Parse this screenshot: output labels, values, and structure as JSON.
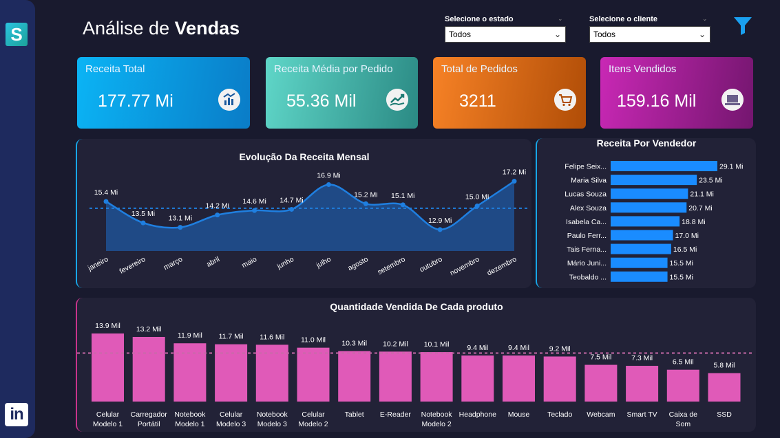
{
  "header": {
    "title_light": "Análise de ",
    "title_bold": "Vendas"
  },
  "filters": [
    {
      "label": "Selecione o estado",
      "value": "Todos"
    },
    {
      "label": "Selecione o cliente",
      "value": "Todos"
    }
  ],
  "kpis": [
    {
      "label": "Receita Total",
      "value": "177.77 Mi",
      "icon": "money-chart-icon"
    },
    {
      "label": "Receita Média por Pedido",
      "value": "55.36 Mil",
      "icon": "trend-hand-icon"
    },
    {
      "label": "Total de Pedidos",
      "value": "3211",
      "icon": "cart-icon"
    },
    {
      "label": "Itens Vendidos",
      "value": "159.16 Mil",
      "icon": "laptop-icon"
    }
  ],
  "colors": {
    "background": "#191a2e",
    "panel": "#222237",
    "line": "#1f7fe0",
    "area": "#1f4f8f",
    "bar_blue": "#1a8cff",
    "bar_pink": "#e05ab8"
  },
  "chart_data": [
    {
      "type": "area",
      "title": "Evolução Da Receita Mensal",
      "categories": [
        "janeiro",
        "fevereiro",
        "março",
        "abril",
        "maio",
        "junho",
        "julho",
        "agosto",
        "setembro",
        "outubro",
        "novembro",
        "dezembro"
      ],
      "values": [
        15.4,
        13.5,
        13.1,
        14.2,
        14.6,
        14.7,
        16.9,
        15.2,
        15.1,
        12.9,
        15.0,
        17.2
      ],
      "data_labels": [
        "15.4 Mi",
        "13.5 Mi",
        "13.1 Mi",
        "14.2 Mi",
        "14.6 Mi",
        "14.7 Mi",
        "16.9 Mi",
        "15.2 Mi",
        "15.1 Mi",
        "12.9 Mi",
        "15.0 Mi",
        "17.2 Mi"
      ],
      "average_line": 14.8,
      "ylim": [
        11,
        17.6
      ]
    },
    {
      "type": "bar",
      "orientation": "horizontal",
      "title": "Receita Por Vendedor",
      "categories": [
        "Felipe Seix...",
        "Maria Silva",
        "Lucas Souza",
        "Alex Souza",
        "Isabela Ca...",
        "Paulo Ferr...",
        "Tais Ferna...",
        "Mário Juni...",
        "Teobaldo ..."
      ],
      "values": [
        29.1,
        23.5,
        21.1,
        20.7,
        18.8,
        17.0,
        16.5,
        15.5,
        15.5
      ],
      "data_labels": [
        "29.1 Mi",
        "23.5 Mi",
        "21.1 Mi",
        "20.7 Mi",
        "18.8 Mi",
        "17.0 Mi",
        "16.5 Mi",
        "15.5 Mi",
        "15.5 Mi"
      ],
      "xlim": [
        0,
        29.1
      ]
    },
    {
      "type": "bar",
      "title": "Quantidade Vendida De Cada produto",
      "categories": [
        [
          "Celular",
          "Modelo 1"
        ],
        [
          "Carregador",
          "Portátil"
        ],
        [
          "Notebook",
          "Modelo 1"
        ],
        [
          "Celular",
          "Modelo 3"
        ],
        [
          "Notebook",
          "Modelo 3"
        ],
        [
          "Celular",
          "Modelo 2"
        ],
        [
          "Tablet"
        ],
        [
          "E-Reader"
        ],
        [
          "Notebook",
          "Modelo 2"
        ],
        [
          "Headphone"
        ],
        [
          "Mouse"
        ],
        [
          "Teclado"
        ],
        [
          "Webcam"
        ],
        [
          "Smart TV"
        ],
        [
          "Caixa de",
          "Som"
        ],
        [
          "SSD"
        ]
      ],
      "values": [
        13.9,
        13.2,
        11.9,
        11.7,
        11.6,
        11.0,
        10.3,
        10.2,
        10.1,
        9.4,
        9.4,
        9.2,
        7.5,
        7.3,
        6.5,
        5.8
      ],
      "data_labels": [
        "13.9 Mil",
        "13.2 Mil",
        "11.9 Mil",
        "11.7 Mil",
        "11.6 Mil",
        "11.0 Mil",
        "10.3 Mil",
        "10.2 Mil",
        "10.1 Mil",
        "9.4 Mil",
        "9.4 Mil",
        "9.2 Mil",
        "7.5 Mil",
        "7.3 Mil",
        "6.5 Mil",
        "5.8 Mil"
      ],
      "average_line": 9.9,
      "ylim": [
        0,
        13.9
      ]
    }
  ]
}
